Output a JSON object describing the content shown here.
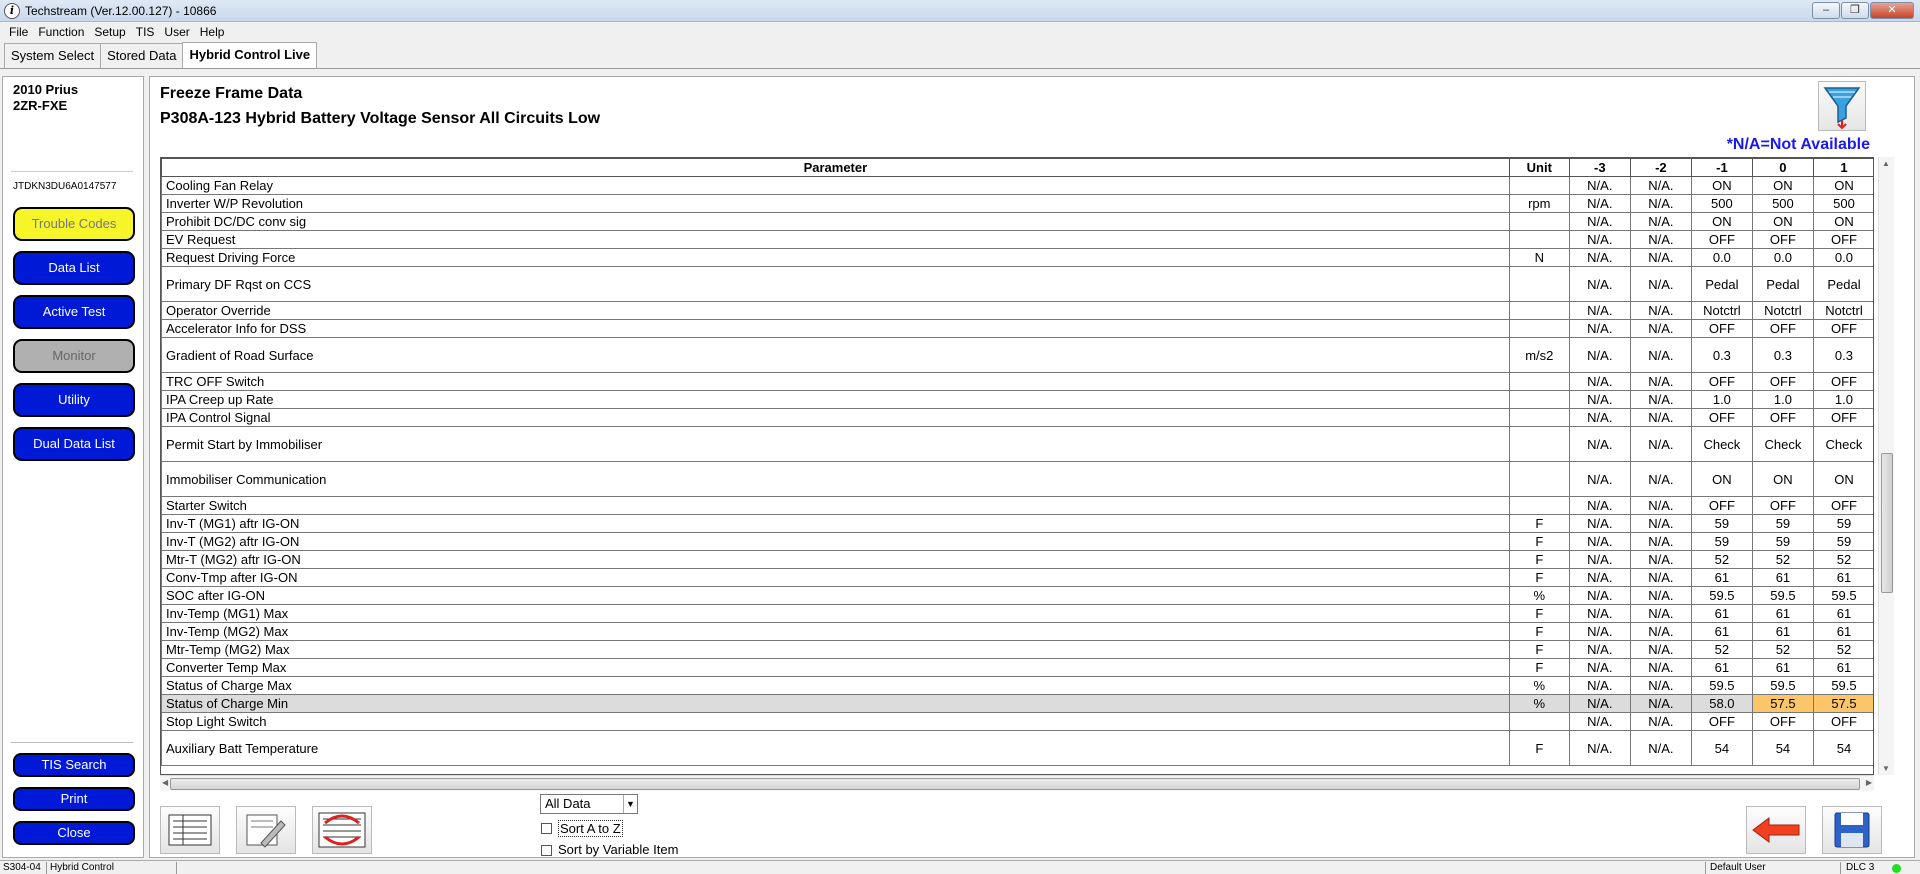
{
  "window": {
    "title": "Techstream (Ver.12.00.127) - 10866"
  },
  "menu": [
    "File",
    "Function",
    "Setup",
    "TIS",
    "User",
    "Help"
  ],
  "tabs": [
    "System Select",
    "Stored Data",
    "Hybrid Control Live"
  ],
  "vehicle": {
    "model": "2010 Prius",
    "engine": "2ZR-FXE",
    "vin": "JTDKN3DU6A0147577"
  },
  "left_buttons": {
    "trouble_codes": "Trouble Codes",
    "data_list": "Data List",
    "active_test": "Active Test",
    "monitor": "Monitor",
    "utility": "Utility",
    "dual_data_list": "Dual Data List",
    "tis_search": "TIS Search",
    "print": "Print",
    "close": "Close"
  },
  "main": {
    "title": "Freeze Frame Data",
    "dtc": "P308A-123 Hybrid Battery Voltage Sensor All Circuits Low",
    "na_note": "*N/A=Not Available"
  },
  "table": {
    "headers": [
      "Parameter",
      "Unit",
      "-3",
      "-2",
      "-1",
      "0",
      "1"
    ],
    "rows": [
      {
        "p": "Cooling Fan Relay",
        "u": "",
        "v": [
          "N/A.",
          "N/A.",
          "ON",
          "ON",
          "ON"
        ],
        "tall": false
      },
      {
        "p": "Inverter W/P Revolution",
        "u": "rpm",
        "v": [
          "N/A.",
          "N/A.",
          "500",
          "500",
          "500"
        ],
        "tall": false
      },
      {
        "p": "Prohibit DC/DC conv sig",
        "u": "",
        "v": [
          "N/A.",
          "N/A.",
          "ON",
          "ON",
          "ON"
        ],
        "tall": false
      },
      {
        "p": "EV Request",
        "u": "",
        "v": [
          "N/A.",
          "N/A.",
          "OFF",
          "OFF",
          "OFF"
        ],
        "tall": false
      },
      {
        "p": "Request Driving Force",
        "u": "N",
        "v": [
          "N/A.",
          "N/A.",
          "0.0",
          "0.0",
          "0.0"
        ],
        "tall": false
      },
      {
        "p": "Primary DF Rqst on CCS",
        "u": "",
        "v": [
          "N/A.",
          "N/A.",
          "Pedal",
          "Pedal",
          "Pedal"
        ],
        "tall": true
      },
      {
        "p": "Operator Override",
        "u": "",
        "v": [
          "N/A.",
          "N/A.",
          "Notctrl",
          "Notctrl",
          "Notctrl"
        ],
        "tall": false
      },
      {
        "p": "Accelerator Info for DSS",
        "u": "",
        "v": [
          "N/A.",
          "N/A.",
          "OFF",
          "OFF",
          "OFF"
        ],
        "tall": false
      },
      {
        "p": "Gradient of Road Surface",
        "u": "m/s2",
        "v": [
          "N/A.",
          "N/A.",
          "0.3",
          "0.3",
          "0.3"
        ],
        "tall": true
      },
      {
        "p": "TRC OFF Switch",
        "u": "",
        "v": [
          "N/A.",
          "N/A.",
          "OFF",
          "OFF",
          "OFF"
        ],
        "tall": false
      },
      {
        "p": "IPA Creep up Rate",
        "u": "",
        "v": [
          "N/A.",
          "N/A.",
          "1.0",
          "1.0",
          "1.0"
        ],
        "tall": false
      },
      {
        "p": "IPA Control Signal",
        "u": "",
        "v": [
          "N/A.",
          "N/A.",
          "OFF",
          "OFF",
          "OFF"
        ],
        "tall": false
      },
      {
        "p": "Permit Start by Immobiliser",
        "u": "",
        "v": [
          "N/A.",
          "N/A.",
          "Check",
          "Check",
          "Check"
        ],
        "tall": true
      },
      {
        "p": "Immobiliser Communication",
        "u": "",
        "v": [
          "N/A.",
          "N/A.",
          "ON",
          "ON",
          "ON"
        ],
        "tall": true
      },
      {
        "p": "Starter Switch",
        "u": "",
        "v": [
          "N/A.",
          "N/A.",
          "OFF",
          "OFF",
          "OFF"
        ],
        "tall": false
      },
      {
        "p": "Inv-T (MG1) aftr IG-ON",
        "u": "F",
        "v": [
          "N/A.",
          "N/A.",
          "59",
          "59",
          "59"
        ],
        "tall": false
      },
      {
        "p": "Inv-T (MG2) aftr IG-ON",
        "u": "F",
        "v": [
          "N/A.",
          "N/A.",
          "59",
          "59",
          "59"
        ],
        "tall": false
      },
      {
        "p": "Mtr-T (MG2) aftr IG-ON",
        "u": "F",
        "v": [
          "N/A.",
          "N/A.",
          "52",
          "52",
          "52"
        ],
        "tall": false
      },
      {
        "p": "Conv-Tmp after IG-ON",
        "u": "F",
        "v": [
          "N/A.",
          "N/A.",
          "61",
          "61",
          "61"
        ],
        "tall": false
      },
      {
        "p": "SOC after IG-ON",
        "u": "%",
        "v": [
          "N/A.",
          "N/A.",
          "59.5",
          "59.5",
          "59.5"
        ],
        "tall": false
      },
      {
        "p": "Inv-Temp (MG1) Max",
        "u": "F",
        "v": [
          "N/A.",
          "N/A.",
          "61",
          "61",
          "61"
        ],
        "tall": false
      },
      {
        "p": "Inv-Temp (MG2) Max",
        "u": "F",
        "v": [
          "N/A.",
          "N/A.",
          "61",
          "61",
          "61"
        ],
        "tall": false
      },
      {
        "p": "Mtr-Temp (MG2) Max",
        "u": "F",
        "v": [
          "N/A.",
          "N/A.",
          "52",
          "52",
          "52"
        ],
        "tall": false
      },
      {
        "p": "Converter Temp Max",
        "u": "F",
        "v": [
          "N/A.",
          "N/A.",
          "61",
          "61",
          "61"
        ],
        "tall": false
      },
      {
        "p": "Status of Charge Max",
        "u": "%",
        "v": [
          "N/A.",
          "N/A.",
          "59.5",
          "59.5",
          "59.5"
        ],
        "tall": false
      },
      {
        "p": "Status of Charge Min",
        "u": "%",
        "v": [
          "N/A.",
          "N/A.",
          "58.0",
          "57.5",
          "57.5"
        ],
        "tall": false,
        "selected": true
      },
      {
        "p": "Stop Light Switch",
        "u": "",
        "v": [
          "N/A.",
          "N/A.",
          "OFF",
          "OFF",
          "OFF"
        ],
        "tall": false
      },
      {
        "p": "Auxiliary Batt Temperature",
        "u": "F",
        "v": [
          "N/A.",
          "N/A.",
          "54",
          "54",
          "54"
        ],
        "tall": true
      }
    ]
  },
  "controls": {
    "filter_selected": "All Data",
    "sort_az": "Sort A to Z",
    "sort_variable": "Sort by Variable Item"
  },
  "status": {
    "code": "S304-04",
    "system": "Hybrid Control",
    "user": "Default User",
    "connection": "DLC 3",
    "connection_color": "#22dd22"
  }
}
